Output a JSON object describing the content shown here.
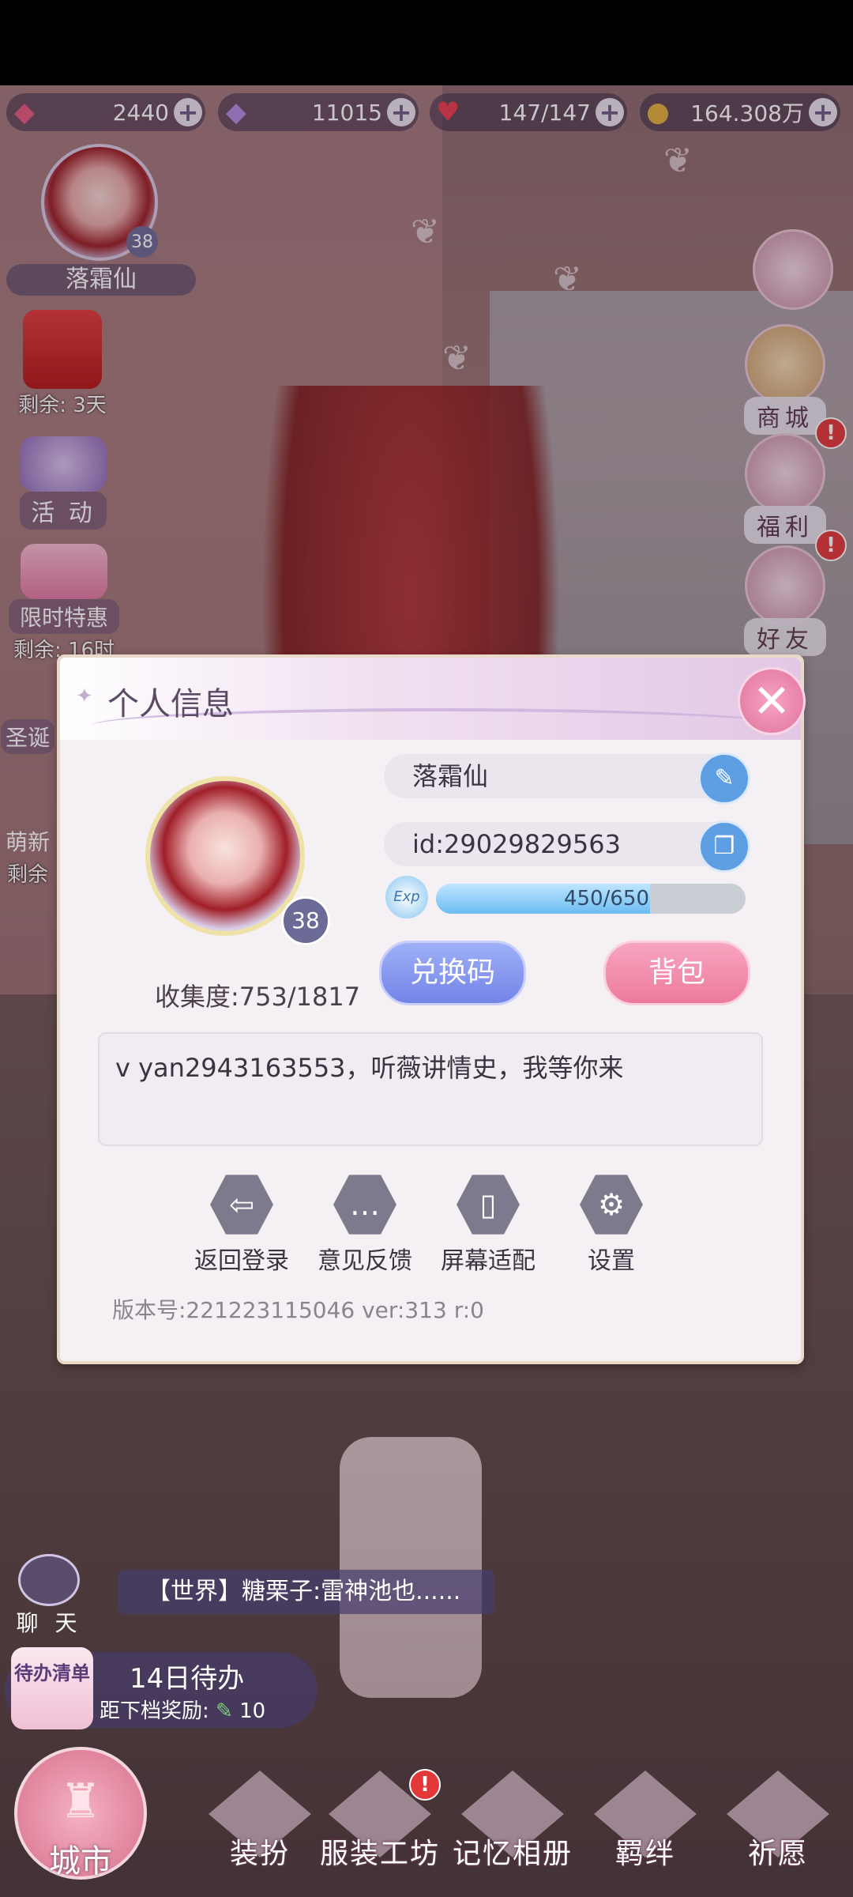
{
  "resources": [
    {
      "icon": "red-gem-icon",
      "value": "2440"
    },
    {
      "icon": "purple-diamond-icon",
      "value": "11015"
    },
    {
      "icon": "heart-icon",
      "value": "147/147"
    },
    {
      "icon": "gold-coin-icon",
      "value": "164.308万"
    }
  ],
  "player": {
    "name": "落霜仙",
    "level": "38"
  },
  "left_menu": {
    "redpacket_remaining": "剩余: 3天",
    "activity": "活 动",
    "limited_offer": "限时特惠",
    "limited_remaining": "剩余: 16时",
    "christmas": "圣诞",
    "newbie": "萌新",
    "newbie_remaining": "剩余"
  },
  "right_menu": {
    "shop": "商城",
    "welfare": "福利",
    "friends": "好友",
    "alert_mark": "!"
  },
  "panel": {
    "title": "个人信息",
    "close_symbol": "✕",
    "name": "落霜仙",
    "id": "id:29029829563",
    "exp_label": "Exp",
    "exp_text": "450/650",
    "exp_current": 450,
    "exp_max": 650,
    "level": "38",
    "collection": "收集度:753/1817",
    "redeem_label": "兑换码",
    "bag_label": "背包",
    "signature": "v  yan2943163553，听薇讲情史，我等你来",
    "actions": [
      "返回登录",
      "意见反馈",
      "屏幕适配",
      "设置"
    ],
    "version": "版本号:221223115046 ver:313 r:0"
  },
  "chat": {
    "label": "聊 天",
    "message": "【世界】糖栗子:雷神池也......"
  },
  "todo": {
    "badge": "待办清单",
    "title": "14日待办",
    "subtitle": "距下档奖励:",
    "count": "10"
  },
  "bottom_nav": [
    "城市",
    "装扮",
    "服装工坊",
    "记忆相册",
    "羁绊",
    "祈愿"
  ]
}
